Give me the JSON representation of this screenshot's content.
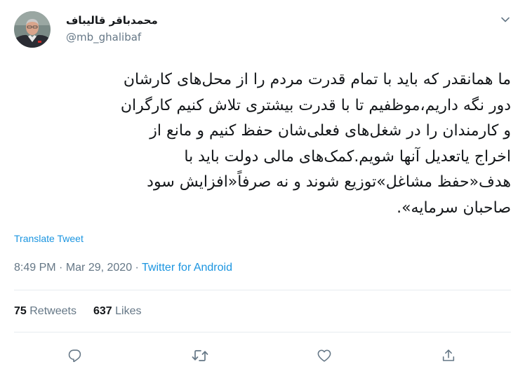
{
  "author": {
    "display_name": "محمدباقر قالیباف",
    "handle": "@mb_ghalibaf"
  },
  "tweet": {
    "lines": [
      "ما همانقدر که باید با تمام قدرت مردم را از محل‌های کارشان",
      "دور نگه داریم،موظفیم تا با قدرت بیشتری تلاش کنیم کارگران",
      "و کارمندان را در شغل‌های فعلی‌شان حفظ کنیم و مانع از",
      "اخراج یاتعدیل آنها شویم.کمک‌های مالی دولت باید با",
      "هدف«حفظ مشاغل»توزیع شوند و نه صرفاً«افزایش سود",
      "صاحبان سرمایه»."
    ],
    "translate_label": "Translate Tweet",
    "time": "8:49 PM",
    "separator": " · ",
    "date": "Mar 29, 2020",
    "source": "Twitter for Android"
  },
  "stats": {
    "retweets_count": "75",
    "retweets_label": "Retweets",
    "likes_count": "637",
    "likes_label": "Likes"
  },
  "icons": {
    "caret": "chevron-down-icon",
    "reply": "reply-icon",
    "retweet": "retweet-icon",
    "like": "heart-icon",
    "share": "share-icon"
  },
  "colors": {
    "link": "#1b95e0",
    "muted": "#657786",
    "text": "#14171a",
    "divider": "#e6ecf0"
  }
}
